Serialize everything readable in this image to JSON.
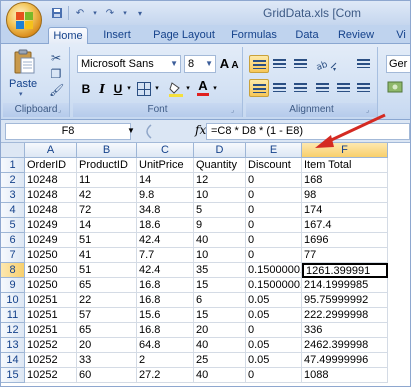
{
  "window": {
    "title": "GridData.xls  [Com"
  },
  "ribbon": {
    "tabs": [
      "Home",
      "Insert",
      "Page Layout",
      "Formulas",
      "Data",
      "Review",
      "Vi"
    ],
    "clipboard": {
      "label": "Clipboard",
      "paste": "Paste"
    },
    "font": {
      "label": "Font",
      "family": "Microsoft Sans",
      "size": "8",
      "grow": "A",
      "shrink": "A",
      "bold": "B",
      "italic": "I",
      "underline": "U",
      "fontcolor": "A"
    },
    "alignment": {
      "label": "Alignment"
    },
    "number": {
      "format": "Ger"
    }
  },
  "formula_bar": {
    "cell_ref": "F8",
    "fx": "fx",
    "formula": "=C8 * D8 * (1 - E8)"
  },
  "grid": {
    "columns": [
      "A",
      "B",
      "C",
      "D",
      "E",
      "F"
    ],
    "rows": [
      {
        "num": "1",
        "cells": [
          "OrderID",
          "ProductID",
          "UnitPrice",
          "Quantity",
          "Discount",
          "Item Total"
        ]
      },
      {
        "num": "2",
        "cells": [
          "10248",
          "11",
          "14",
          "12",
          "0",
          "168"
        ]
      },
      {
        "num": "3",
        "cells": [
          "10248",
          "42",
          "9.8",
          "10",
          "0",
          "98"
        ]
      },
      {
        "num": "4",
        "cells": [
          "10248",
          "72",
          "34.8",
          "5",
          "0",
          "174"
        ]
      },
      {
        "num": "5",
        "cells": [
          "10249",
          "14",
          "18.6",
          "9",
          "0",
          "167.4"
        ]
      },
      {
        "num": "6",
        "cells": [
          "10249",
          "51",
          "42.4",
          "40",
          "0",
          "1696"
        ]
      },
      {
        "num": "7",
        "cells": [
          "10250",
          "41",
          "7.7",
          "10",
          "0",
          "77"
        ]
      },
      {
        "num": "8",
        "cells": [
          "10250",
          "51",
          "42.4",
          "35",
          "0.15000001",
          "1261.399991"
        ]
      },
      {
        "num": "9",
        "cells": [
          "10250",
          "65",
          "16.8",
          "15",
          "0.15000001",
          "214.1999985"
        ]
      },
      {
        "num": "10",
        "cells": [
          "10251",
          "22",
          "16.8",
          "6",
          "0.05",
          "95.75999992"
        ]
      },
      {
        "num": "11",
        "cells": [
          "10251",
          "57",
          "15.6",
          "15",
          "0.05",
          "222.2999998"
        ]
      },
      {
        "num": "12",
        "cells": [
          "10251",
          "65",
          "16.8",
          "20",
          "0",
          "336"
        ]
      },
      {
        "num": "13",
        "cells": [
          "10252",
          "20",
          "64.8",
          "40",
          "0.05",
          "2462.399998"
        ]
      },
      {
        "num": "14",
        "cells": [
          "10252",
          "33",
          "2",
          "25",
          "0.05",
          "47.49999996"
        ]
      },
      {
        "num": "15",
        "cells": [
          "10252",
          "60",
          "27.2",
          "40",
          "0",
          "1088"
        ]
      }
    ]
  },
  "colors": {
    "accent": "#c9302c",
    "ribbon": "#d4e2f4",
    "selected_header": "#f8cf6c"
  }
}
